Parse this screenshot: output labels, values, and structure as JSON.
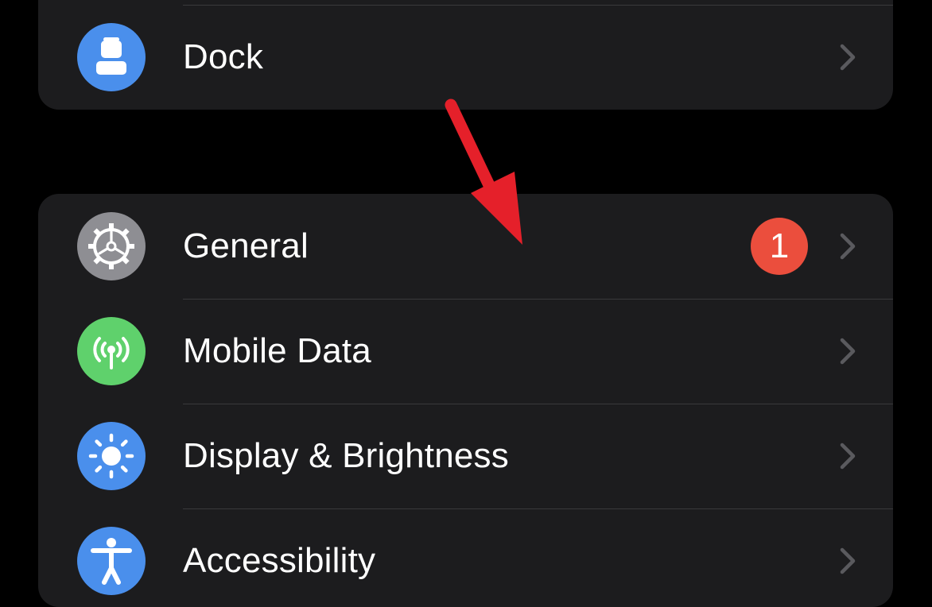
{
  "colors": {
    "background": "#000000",
    "group_background": "#1c1c1e",
    "separator": "#3a3a3c",
    "dock_icon": "#4a8fec",
    "general_icon": "#8e8e93",
    "mobile_data_icon": "#5fd16c",
    "display_icon": "#4a8fec",
    "accessibility_icon": "#4a8fec",
    "badge": "#eb4e3d",
    "chevron": "#5a5a5e",
    "annotation_arrow": "#e5202a"
  },
  "top_group": {
    "dock": {
      "label": "Dock",
      "icon": "dock-icon"
    }
  },
  "main_group": {
    "general": {
      "label": "General",
      "icon": "gear-icon",
      "badge": "1"
    },
    "mobile_data": {
      "label": "Mobile Data",
      "icon": "antenna-icon"
    },
    "display": {
      "label": "Display & Brightness",
      "icon": "sun-icon"
    },
    "accessibility": {
      "label": "Accessibility",
      "icon": "accessibility-icon"
    }
  },
  "annotation": {
    "icon": "red-arrow-icon",
    "points_to": "general-row"
  }
}
